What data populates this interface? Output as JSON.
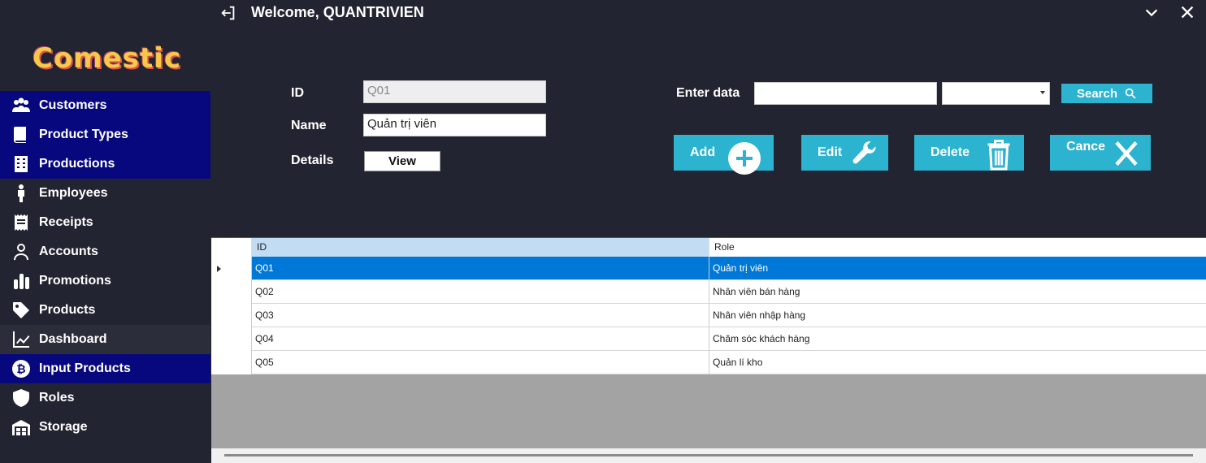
{
  "header": {
    "welcome": "Welcome, QUANTRIVIEN"
  },
  "logo": {
    "text": "Comestic",
    "color": "#f7c948"
  },
  "sidebar": {
    "items": [
      {
        "label": "Customers",
        "icon": "users-icon"
      },
      {
        "label": "Product Types",
        "icon": "book-icon"
      },
      {
        "label": "Productions",
        "icon": "building-icon"
      },
      {
        "label": "Employees",
        "icon": "person-icon"
      },
      {
        "label": "Receipts",
        "icon": "receipt-icon"
      },
      {
        "label": "Accounts",
        "icon": "user-outline-icon"
      },
      {
        "label": "Promotions",
        "icon": "bar-chart-icon"
      },
      {
        "label": "Products",
        "icon": "tag-icon"
      },
      {
        "label": "Dashboard",
        "icon": "line-chart-icon"
      },
      {
        "label": "Input Products",
        "icon": "bitcoin-icon"
      },
      {
        "label": "Roles",
        "icon": "shield-icon"
      },
      {
        "label": "Storage",
        "icon": "warehouse-icon"
      }
    ]
  },
  "form": {
    "id_label": "ID",
    "id_value": "Q01",
    "name_label": "Name",
    "name_value": "Quản trị viên",
    "details_label": "Details",
    "view_label": "View",
    "enter_data_label": "Enter data",
    "search_value": "",
    "search_label": "Search"
  },
  "actions": {
    "add": "Add",
    "edit": "Edit",
    "delete": "Delete",
    "cancel": "Cance"
  },
  "table": {
    "headers": [
      "ID",
      "Role"
    ],
    "rows": [
      {
        "id": "Q01",
        "role": "Quản trị viên"
      },
      {
        "id": "Q02",
        "role": "Nhân viên bán hàng"
      },
      {
        "id": "Q03",
        "role": "Nhân viên nhập hàng"
      },
      {
        "id": "Q04",
        "role": "Chăm sóc khách hàng"
      },
      {
        "id": "Q05",
        "role": "Quản lí kho"
      }
    ]
  },
  "colors": {
    "sidebar_active": "#08087e",
    "accent": "#2bb3d0",
    "selected_row": "#0078d7",
    "background": "#232431"
  }
}
